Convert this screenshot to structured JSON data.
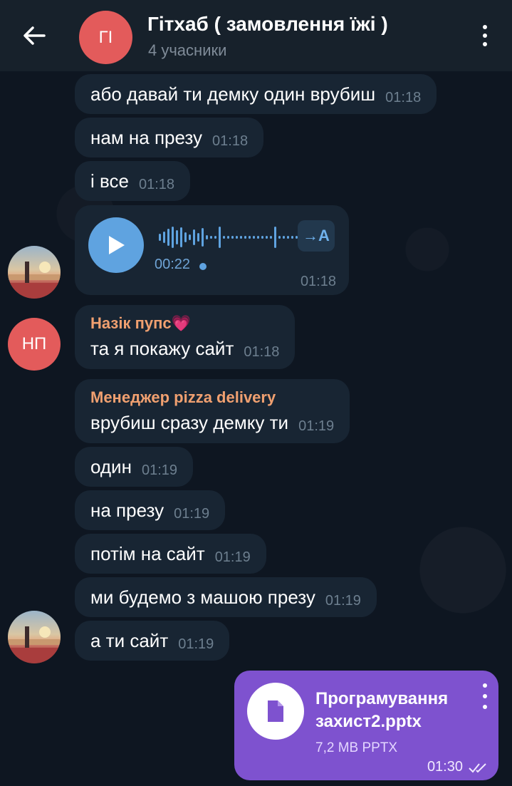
{
  "header": {
    "title": "Гітхаб ( замовлення їжі )",
    "subtitle": "4 учасники",
    "avatar_initials": "ГІ",
    "back_icon": "back-arrow-icon",
    "menu_icon": "more-vertical-icon"
  },
  "messages": [
    {
      "text": "або давай ти демку один врубиш",
      "time": "01:18"
    },
    {
      "text": "нам на презу",
      "time": "01:18"
    },
    {
      "text": "і все",
      "time": "01:18"
    },
    {
      "type": "voice",
      "duration": "00:22",
      "time": "01:18",
      "transcribe_label": "→A"
    },
    {
      "sender": "Назік пупс💗",
      "text": "та я покажу сайт",
      "time": "01:18",
      "avatar_initials": "НП"
    },
    {
      "sender": "Менеджер pizza delivery",
      "text": "врубиш сразу демку ти",
      "time": "01:19"
    },
    {
      "text": "один",
      "time": "01:19"
    },
    {
      "text": "на презу",
      "time": "01:19"
    },
    {
      "text": "потім на сайт",
      "time": "01:19"
    },
    {
      "text": "ми будемо з машою презу",
      "time": "01:19"
    },
    {
      "text": "а ти сайт",
      "time": "01:19"
    },
    {
      "type": "file",
      "outgoing": true,
      "file_name": "Програмування захист2.pptx",
      "file_meta": "7,2 MB PPTX",
      "time": "01:30"
    }
  ],
  "colors": {
    "background": "#0e1621",
    "header": "#17212b",
    "incoming_bubble": "#182533",
    "outgoing_bubble": "#7e52cf",
    "accent": "#5fa3e0",
    "sender_name": "#f0a070",
    "avatar_red": "#e35b5b"
  }
}
